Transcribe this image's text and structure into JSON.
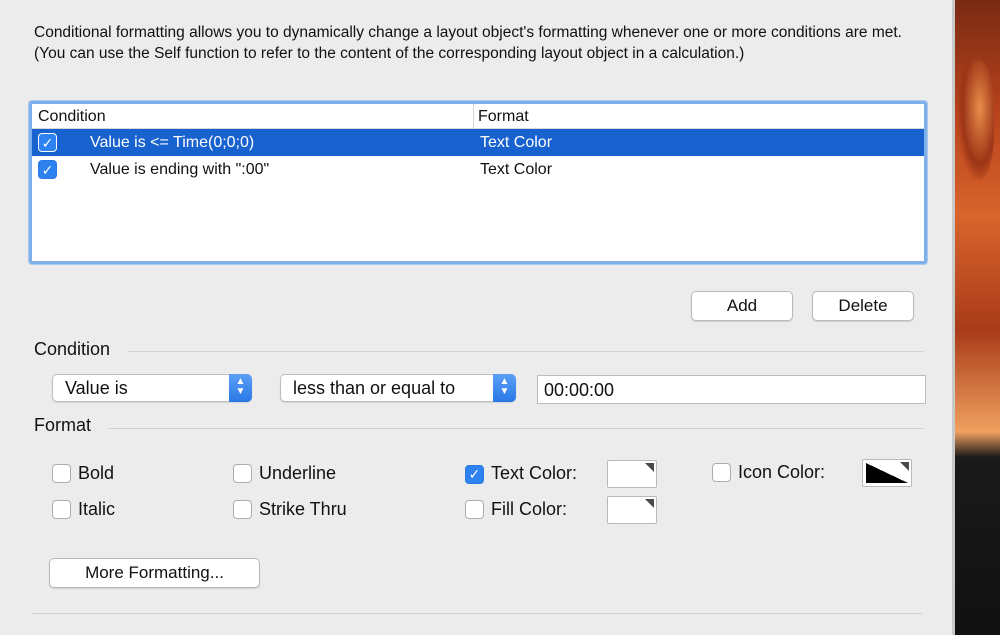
{
  "intro_text": "Conditional formatting allows you to dynamically change a layout object's formatting whenever one or more conditions are met.  (You can use the Self function to refer to the content of the corresponding layout object in a calculation.)",
  "list": {
    "headers": {
      "condition": "Condition",
      "format": "Format"
    },
    "rows": [
      {
        "condition": "Value is <= Time(0;0;0)",
        "format": "Text Color",
        "checked": true,
        "selected": true
      },
      {
        "condition": "Value is ending with \":00\"",
        "format": "Text Color",
        "checked": true,
        "selected": false
      }
    ]
  },
  "buttons": {
    "add": "Add",
    "delete": "Delete",
    "more_formatting": "More Formatting..."
  },
  "condition_section": {
    "label": "Condition",
    "type_select": "Value is",
    "operator_select": "less than or equal to",
    "value": "00:00:00"
  },
  "format_section": {
    "label": "Format",
    "bold": {
      "label": "Bold",
      "checked": false
    },
    "italic": {
      "label": "Italic",
      "checked": false
    },
    "underline": {
      "label": "Underline",
      "checked": false
    },
    "strike_thru": {
      "label": "Strike Thru",
      "checked": false
    },
    "text_color": {
      "label": "Text Color:",
      "checked": true
    },
    "fill_color": {
      "label": "Fill Color:",
      "checked": false
    },
    "icon_color": {
      "label": "Icon Color:",
      "checked": false
    }
  },
  "colors": {
    "selection": "#1862d0",
    "accent": "#2e82ef"
  },
  "icons": {
    "checkmark": "checkmark-icon",
    "stepper": "up-down-chevron-icon"
  }
}
